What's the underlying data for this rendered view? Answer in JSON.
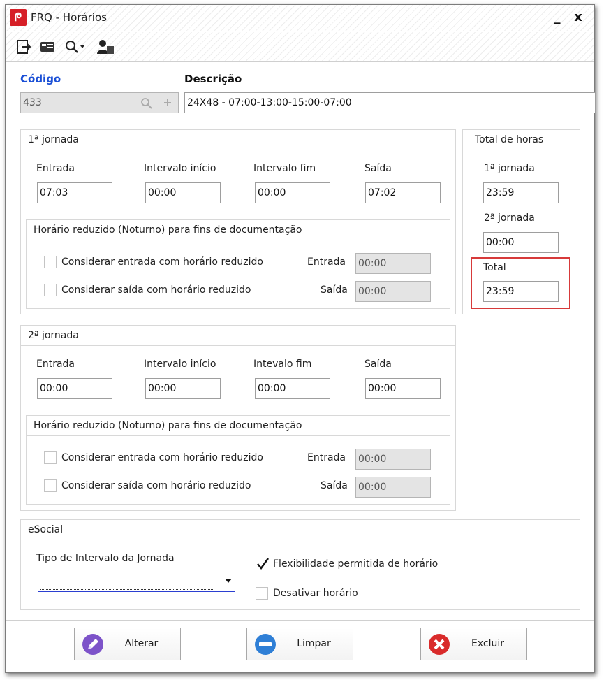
{
  "window": {
    "title": "FRQ - Horários",
    "minimize_glyph": "_",
    "close_glyph": "x"
  },
  "toolbar": {
    "icons": [
      "exit-icon",
      "card-icon",
      "search-dropdown-icon",
      "user-icon"
    ]
  },
  "codigo": {
    "label": "Código",
    "value": "433"
  },
  "descricao": {
    "label": "Descrição",
    "value": "24X48 - 07:00-13:00-15:00-07:00"
  },
  "jornada1": {
    "title": "1ª jornada",
    "entrada_label": "Entrada",
    "entrada": "07:03",
    "intervalo_inicio_label": "Intervalo início",
    "intervalo_inicio": "00:00",
    "intervalo_fim_label": "Intervalo fim",
    "intervalo_fim": "00:00",
    "saida_label": "Saída",
    "saida": "07:02",
    "reduzido": {
      "title": "Horário reduzido (Noturno) para fins de documentação",
      "entrada_check_label": "Considerar entrada com horário reduzido",
      "saida_check_label": "Considerar saída com horário reduzido",
      "entrada_label": "Entrada",
      "entrada": "00:00",
      "saida_label": "Saída",
      "saida": "00:00"
    }
  },
  "jornada2": {
    "title": "2ª jornada",
    "entrada_label": "Entrada",
    "entrada": "00:00",
    "intervalo_inicio_label": "Intervalo início",
    "intervalo_inicio": "00:00",
    "intervalo_fim_label": "Intevalo fim",
    "intervalo_fim": "00:00",
    "saida_label": "Saída",
    "saida": "00:00",
    "reduzido": {
      "title": "Horário reduzido (Noturno) para fins de documentação",
      "entrada_check_label": "Considerar entrada com horário reduzido",
      "saida_check_label": "Considerar saída com horário reduzido",
      "entrada_label": "Entrada",
      "entrada": "00:00",
      "saida_label": "Saída",
      "saida": "00:00"
    }
  },
  "total_horas": {
    "title": "Total de horas",
    "j1_label": "1ª jornada",
    "j1": "23:59",
    "j2_label": "2ª jornada",
    "j2": "00:00",
    "total_label": "Total",
    "total": "23:59"
  },
  "esocial": {
    "title": "eSocial",
    "tipo_intervalo_label": "Tipo de Intervalo da Jornada",
    "tipo_intervalo_value": "",
    "flexibilidade_label": "Flexibilidade permitida de horário",
    "flexibilidade_checked": true,
    "desativar_label": "Desativar horário",
    "desativar_checked": false
  },
  "buttons": {
    "alterar": "Alterar",
    "limpar": "Limpar",
    "excluir": "Excluir"
  },
  "colors": {
    "accent_blue": "#1a4fd6",
    "highlight_red": "#d73a3a",
    "brand_red": "#d61f27"
  }
}
